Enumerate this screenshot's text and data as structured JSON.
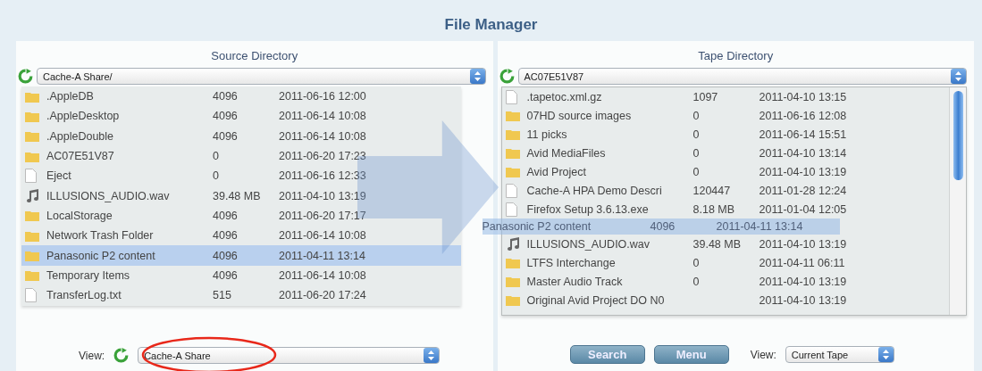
{
  "title": "File Manager",
  "source": {
    "heading": "Source Directory",
    "path": "Cache-A Share/",
    "rows": [
      {
        "name": ".AppleDB",
        "size": "4096",
        "date": "2011-06-16 12:00",
        "kind": "folder",
        "selected": false
      },
      {
        "name": ".AppleDesktop",
        "size": "4096",
        "date": "2011-06-14 10:08",
        "kind": "folder",
        "selected": false
      },
      {
        "name": ".AppleDouble",
        "size": "4096",
        "date": "2011-06-14 10:08",
        "kind": "folder",
        "selected": false
      },
      {
        "name": "AC07E51V87",
        "size": "0",
        "date": "2011-06-20 17:23",
        "kind": "folder",
        "selected": false
      },
      {
        "name": "Eject",
        "size": "0",
        "date": "2011-06-16 12:33",
        "kind": "file",
        "selected": false
      },
      {
        "name": "ILLUSIONS_AUDIO.wav",
        "size": "39.48 MB",
        "date": "2011-04-10 13:19",
        "kind": "audio",
        "selected": false
      },
      {
        "name": "LocalStorage",
        "size": "4096",
        "date": "2011-06-20 17:17",
        "kind": "folder",
        "selected": false
      },
      {
        "name": "Network Trash Folder",
        "size": "4096",
        "date": "2011-06-14 10:08",
        "kind": "folder",
        "selected": false
      },
      {
        "name": "Panasonic P2 content",
        "size": "4096",
        "date": "2011-04-11 13:14",
        "kind": "folder",
        "selected": true
      },
      {
        "name": "Temporary Items",
        "size": "4096",
        "date": "2011-06-14 10:08",
        "kind": "folder",
        "selected": false
      },
      {
        "name": "TransferLog.txt",
        "size": "515",
        "date": "2011-06-20 17:24",
        "kind": "file",
        "selected": false
      }
    ],
    "view_label": "View:",
    "view": "Cache-A Share"
  },
  "tape": {
    "heading": "Tape Directory",
    "path": "AC07E51V87",
    "rows": [
      {
        "name": ".tapetoc.xml.gz",
        "size": "1097",
        "date": "2011-04-10 13:15",
        "kind": "file",
        "selected": false
      },
      {
        "name": "07HD source images",
        "size": "0",
        "date": "2011-06-16 12:08",
        "kind": "folder",
        "selected": false
      },
      {
        "name": "11 picks",
        "size": "0",
        "date": "2011-06-14 15:51",
        "kind": "folder",
        "selected": false
      },
      {
        "name": "Avid MediaFiles",
        "size": "0",
        "date": "2011-04-10 13:14",
        "kind": "folder",
        "selected": false
      },
      {
        "name": "Avid Project",
        "size": "0",
        "date": "2011-04-10 13:19",
        "kind": "folder",
        "selected": false
      },
      {
        "name": "Cache-A HPA Demo Descri",
        "size": "120447",
        "date": "2011-01-28 12:24",
        "kind": "file",
        "selected": false
      },
      {
        "name": "Firefox Setup 3.6.13.exe",
        "size": "8.18 MB",
        "date": "2011-01-04 12:05",
        "kind": "file",
        "selected": false
      },
      {
        "name": "Panasonic P2 content",
        "size": "4096",
        "date": "2011-04-11 13:14",
        "kind": "drag",
        "selected": true
      },
      {
        "name": "ILLUSIONS_AUDIO.wav",
        "size": "39.48 MB",
        "date": "2011-04-10 13:19",
        "kind": "audio",
        "selected": false
      },
      {
        "name": "LTFS Interchange",
        "size": "0",
        "date": "2011-04-11 06:11",
        "kind": "folder",
        "selected": false
      },
      {
        "name": "Master Audio Track",
        "size": "0",
        "date": "2011-04-10 13:19",
        "kind": "folder",
        "selected": false
      },
      {
        "name": "Original Avid Project DO N0",
        "date": "2011-04-10 13:19",
        "kind": "folder",
        "selected": false
      }
    ],
    "buttons": [
      "Search",
      "Menu"
    ],
    "view_label": "View:",
    "view": "Current Tape"
  }
}
